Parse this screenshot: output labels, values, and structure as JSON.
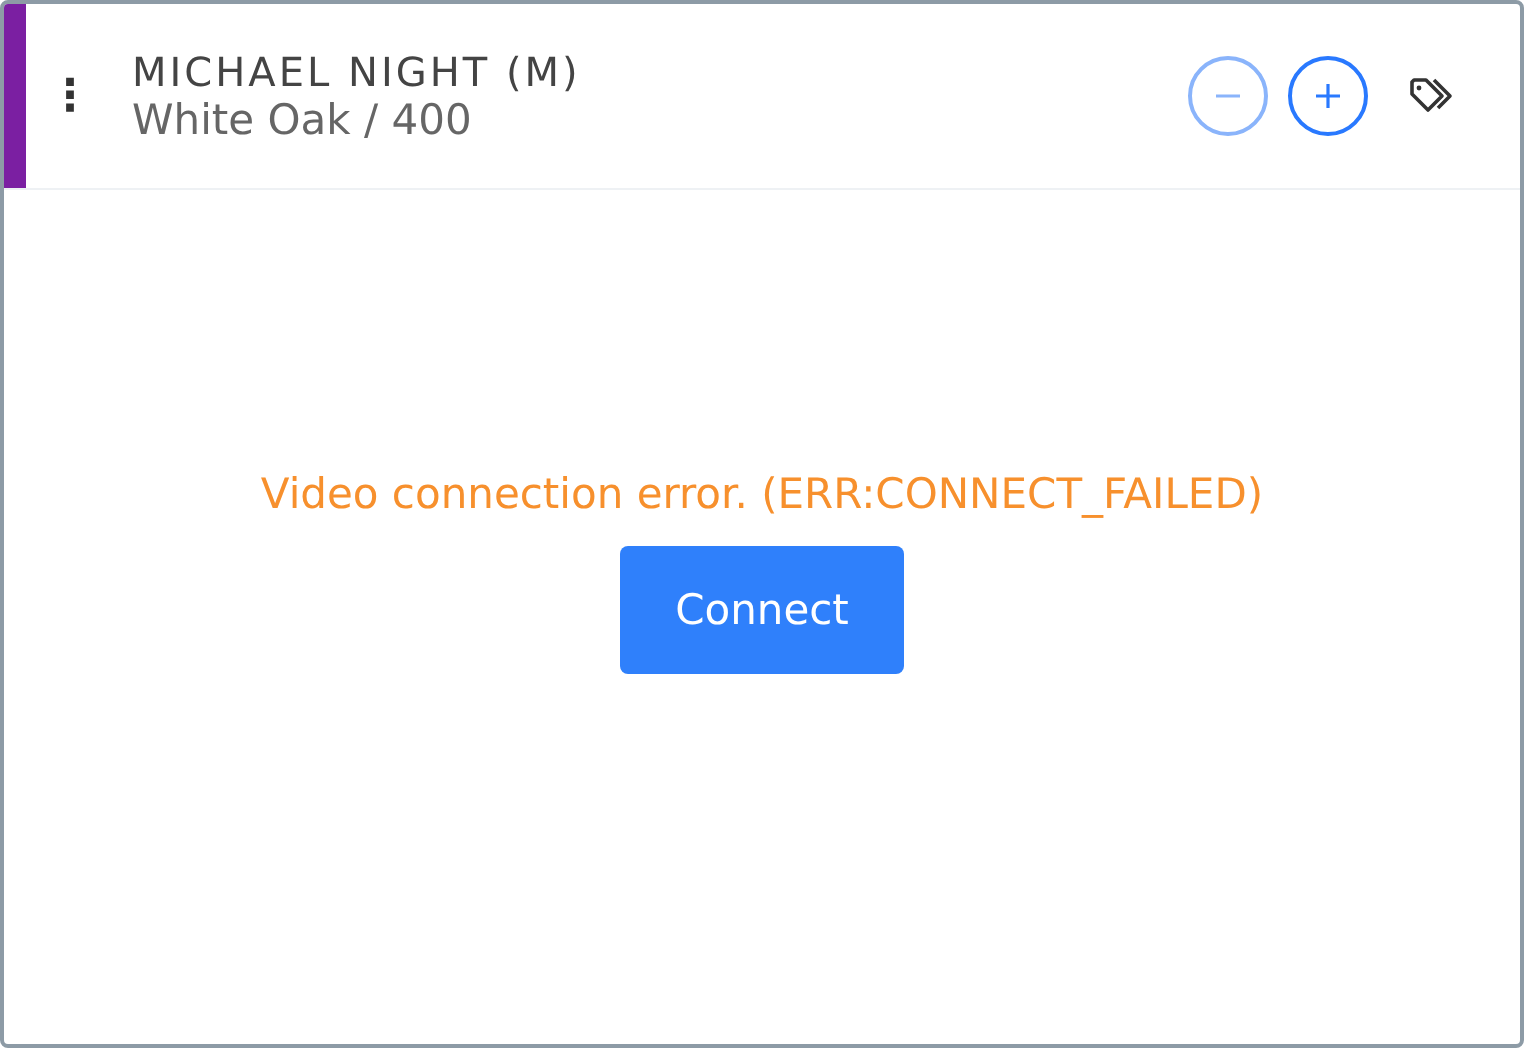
{
  "header": {
    "name": "MICHAEL NIGHT (M)",
    "location": "White Oak / 400",
    "color": "#7b1fa2"
  },
  "controls": {
    "menu_icon": "⋮",
    "zoom_out_disabled": true,
    "zoom_in_disabled": false
  },
  "message": {
    "text": "Video connection error. (ERR:CONNECT_FAILED)",
    "kind": "error"
  },
  "buttons": [
    {
      "label": "Connect"
    }
  ]
}
